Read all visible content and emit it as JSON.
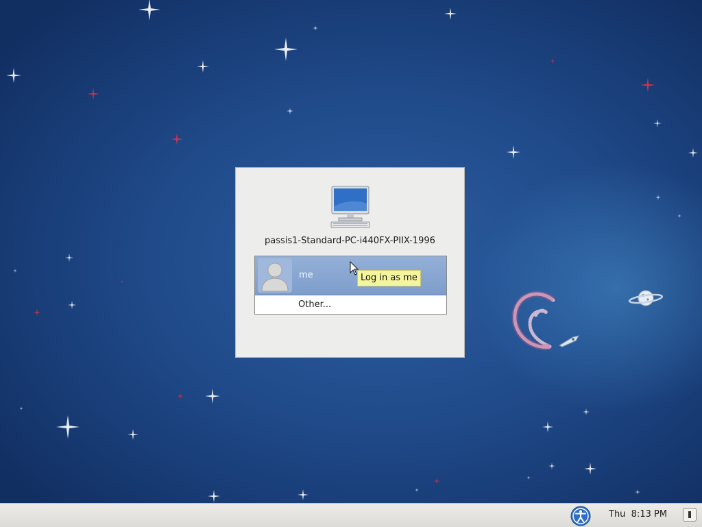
{
  "desktop": {
    "wallpaper": "debian-space-wallpaper",
    "colors": {
      "background": "#1d4583",
      "star": "#ffffff",
      "red_star": "#d8344a"
    }
  },
  "login": {
    "hostname": "passis1-Standard-PC-i440FX-PIIX-1996",
    "computer_icon": "computer-icon",
    "users": [
      {
        "name": "me",
        "icon": "user-avatar-icon",
        "selected": true
      }
    ],
    "other_label": "Other...",
    "tooltip": "Log in as me",
    "selection_color": "#86a4cf"
  },
  "taskbar": {
    "accessibility_icon": "accessibility-icon",
    "clock": "Thu  8:13 PM",
    "power_icon": "power-icon"
  }
}
